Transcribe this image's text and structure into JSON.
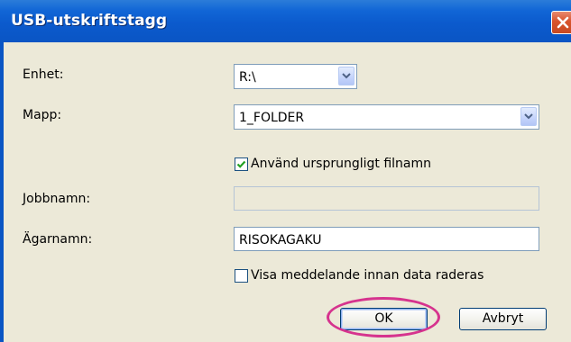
{
  "window": {
    "title": "USB-utskriftstagg"
  },
  "fields": {
    "device_label": "Enhet:",
    "device_value": "R:\\",
    "folder_label": "Mapp:",
    "folder_value": "1_FOLDER",
    "use_original_filename_label": "Använd ursprungligt filnamn",
    "use_original_filename_checked": true,
    "job_name_label": "Jobbnamn:",
    "job_name_value": "",
    "owner_name_label": "Ägarnamn:",
    "owner_name_value": "RISOKAGAKU",
    "show_message_label": "Visa meddelande innan data raderas",
    "show_message_checked": false
  },
  "buttons": {
    "ok": "OK",
    "cancel": "Avbryt"
  },
  "colors": {
    "titlebar": "#0a55c4",
    "close_button": "#d8542d",
    "dialog_background": "#ece9d8",
    "highlight": "#d6338e"
  },
  "icons": {
    "close": "close-icon",
    "dropdown": "chevron-down-icon",
    "check": "check-icon"
  }
}
